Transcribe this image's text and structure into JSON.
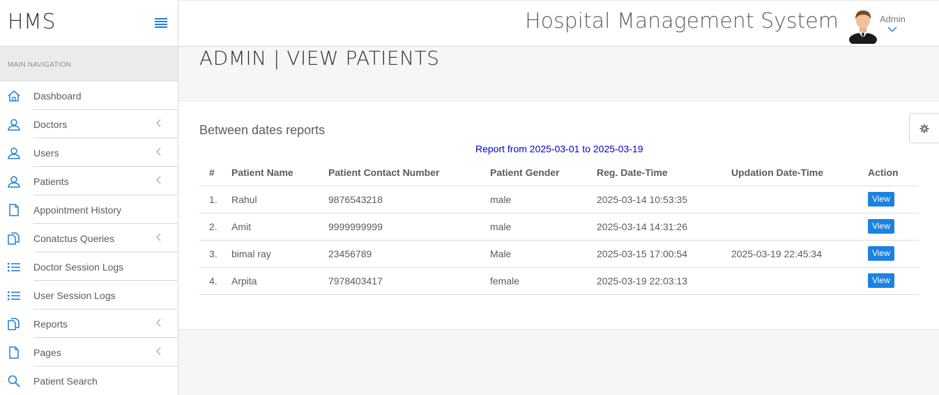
{
  "brand": {
    "name": "HMS"
  },
  "sidebar": {
    "nav_header": "MAIN NAVIGATION",
    "items": [
      {
        "label": "Dashboard",
        "icon": "home-icon",
        "has_submenu": false
      },
      {
        "label": "Doctors",
        "icon": "user-icon",
        "has_submenu": true
      },
      {
        "label": "Users",
        "icon": "user-icon",
        "has_submenu": true
      },
      {
        "label": "Patients",
        "icon": "user-icon",
        "has_submenu": true
      },
      {
        "label": "Appointment History",
        "icon": "file-icon",
        "has_submenu": false
      },
      {
        "label": "Conatctus Queries",
        "icon": "files-icon",
        "has_submenu": true
      },
      {
        "label": "Doctor Session Logs",
        "icon": "list-icon",
        "has_submenu": false
      },
      {
        "label": "User Session Logs",
        "icon": "list-icon",
        "has_submenu": false
      },
      {
        "label": "Reports",
        "icon": "files-icon",
        "has_submenu": true
      },
      {
        "label": "Pages",
        "icon": "file-icon",
        "has_submenu": true
      },
      {
        "label": "Patient Search",
        "icon": "search-icon",
        "has_submenu": false
      }
    ]
  },
  "topbar": {
    "app_title": "Hospital Management System",
    "user_label": "Admin"
  },
  "page": {
    "title": "ADMIN | VIEW PATIENTS",
    "panel_heading": "Between dates reports",
    "report_range": "Report from 2025-03-01 to 2025-03-19"
  },
  "table": {
    "headers": [
      "#",
      "Patient Name",
      "Patient Contact Number",
      "Patient Gender",
      "Reg. Date-Time",
      "Updation Date-Time",
      "Action"
    ],
    "rows": [
      {
        "num": "1.",
        "name": "Rahul",
        "contact": "9876543218",
        "gender": "male",
        "reg": "2025-03-14 10:53:35",
        "updated": "",
        "action": "View"
      },
      {
        "num": "2.",
        "name": "Amit",
        "contact": "9999999999",
        "gender": "male",
        "reg": "2025-03-14 14:31:26",
        "updated": "",
        "action": "View"
      },
      {
        "num": "3.",
        "name": "bimal ray",
        "contact": "23456789",
        "gender": "Male",
        "reg": "2025-03-15 17:00:54",
        "updated": "2025-03-19 22:45:34",
        "action": "View"
      },
      {
        "num": "4.",
        "name": "Arpita",
        "contact": "7978403417",
        "gender": "female",
        "reg": "2025-03-19 22:03:13",
        "updated": "",
        "action": "View"
      }
    ]
  },
  "colors": {
    "accent": "#1a82e2",
    "report_range": "#0000cc",
    "icon": "#1e7fd7"
  }
}
